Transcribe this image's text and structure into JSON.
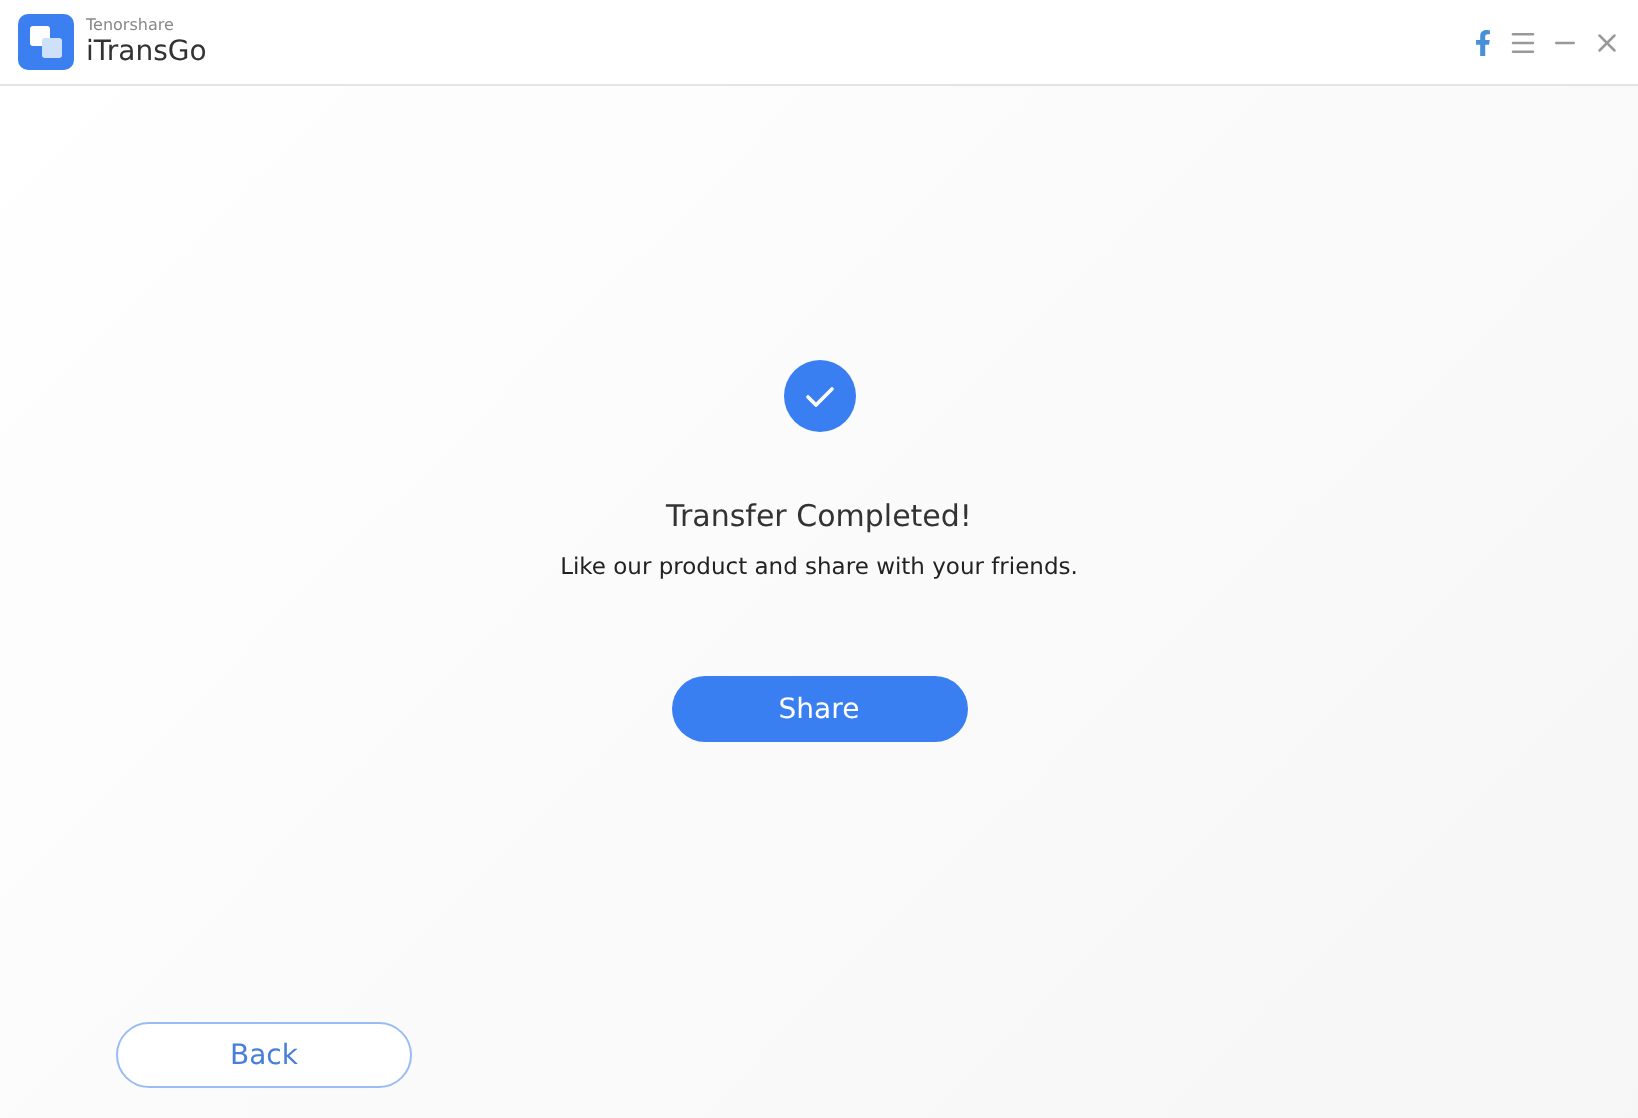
{
  "window": {
    "vendor": "Tenorshare",
    "title": "iTransGo"
  },
  "result": {
    "title": "Transfer Completed!",
    "message": "Like our product and share with your friends."
  },
  "buttons": {
    "share": "Share",
    "back": "Back"
  }
}
